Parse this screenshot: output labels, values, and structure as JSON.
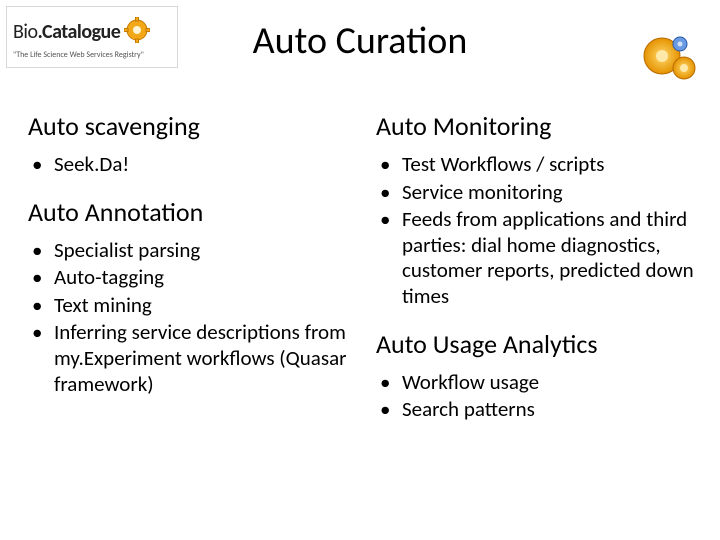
{
  "logo": {
    "name_prefix": "Bio",
    "name_suffix": ".Catalogue",
    "tagline": "\"The Life Science Web Services Registry\""
  },
  "title": "Auto Curation",
  "left": {
    "section1": {
      "heading": "Auto scavenging",
      "items": [
        "Seek.Da!"
      ]
    },
    "section2": {
      "heading": "Auto Annotation",
      "items": [
        "Specialist parsing",
        "Auto-tagging",
        "Text mining",
        "Inferring service descriptions from my.Experiment workflows (Quasar framework)"
      ]
    }
  },
  "right": {
    "section1": {
      "heading": "Auto Monitoring",
      "items": [
        "Test Workflows / scripts",
        "Service monitoring",
        "Feeds from applications and third parties: dial home diagnostics, customer reports, predicted down times"
      ]
    },
    "section2": {
      "heading": "Auto Usage Analytics",
      "items": [
        "Workflow usage",
        "Search patterns"
      ]
    }
  }
}
